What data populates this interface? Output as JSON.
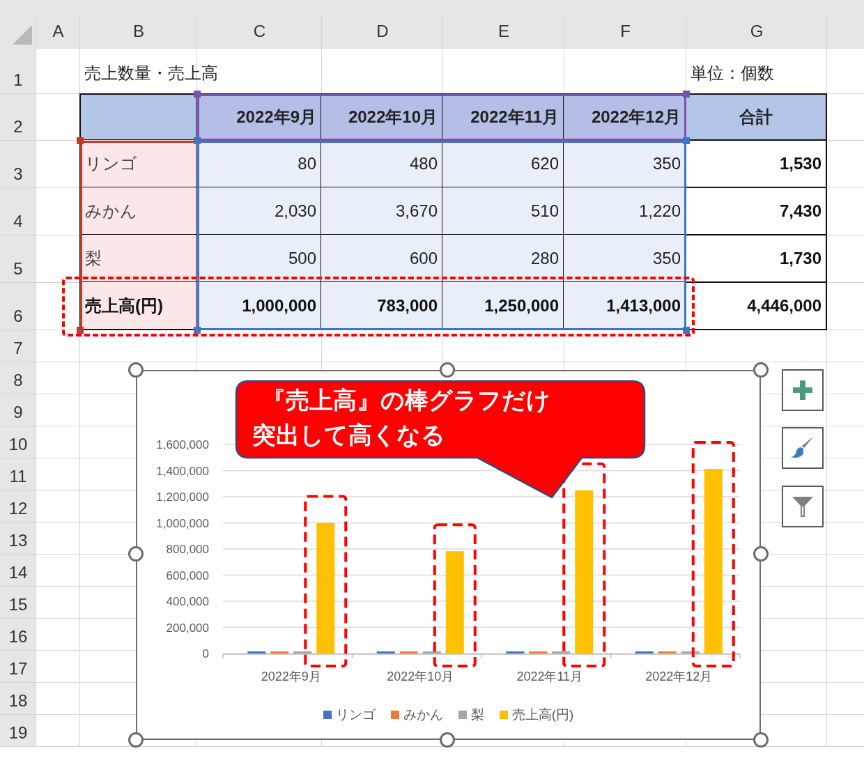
{
  "columns": [
    "A",
    "B",
    "C",
    "D",
    "E",
    "F",
    "G"
  ],
  "row_numbers": [
    "1",
    "2",
    "3",
    "4",
    "5",
    "6",
    "7",
    "8",
    "9",
    "10",
    "11",
    "12",
    "13",
    "14",
    "15",
    "16",
    "17",
    "18",
    "19"
  ],
  "sheet_title": "売上数量・売上高",
  "unit_note": "単位：個数",
  "table": {
    "header": [
      "2022年9月",
      "2022年10月",
      "2022年11月",
      "2022年12月",
      "合計"
    ],
    "rows": [
      {
        "kind": "quantity",
        "label": "リンゴ",
        "values": [
          "80",
          "480",
          "620",
          "350"
        ],
        "total": "1,530"
      },
      {
        "kind": "quantity",
        "label": "みかん",
        "values": [
          "2,030",
          "3,670",
          "510",
          "1,220"
        ],
        "total": "7,430"
      },
      {
        "kind": "quantity",
        "label": "梨",
        "values": [
          "500",
          "600",
          "280",
          "350"
        ],
        "total": "1,730"
      },
      {
        "kind": "sales",
        "label": "売上高(円)",
        "values": [
          "1,000,000",
          "783,000",
          "1,250,000",
          "1,413,000"
        ],
        "total": "4,446,000",
        "highlighted": true
      }
    ]
  },
  "chart": {
    "last_series_bars_framed": true,
    "callout": [
      "『売上高』の棒グラフだけ",
      "突出して高くなる"
    ],
    "chart_data": {
      "type": "bar",
      "categories": [
        "2022年9月",
        "2022年10月",
        "2022年11月",
        "2022年12月"
      ],
      "series": [
        {
          "name": "リンゴ",
          "color": "#4472c4",
          "values": [
            80,
            480,
            620,
            350
          ]
        },
        {
          "name": "みかん",
          "color": "#ed7d31",
          "values": [
            2030,
            3670,
            510,
            1220
          ]
        },
        {
          "name": "梨",
          "color": "#a5a5a5",
          "values": [
            500,
            600,
            280,
            350
          ]
        },
        {
          "name": "売上高(円)",
          "color": "#ffc000",
          "values": [
            1000000,
            783000,
            1250000,
            1413000
          ]
        }
      ],
      "grid": true,
      "ylim": [
        0,
        1600000
      ],
      "yticks": [
        {
          "value": 0,
          "label": "0"
        },
        {
          "value": 200000,
          "label": "200,000"
        },
        {
          "value": 400000,
          "label": "400,000"
        },
        {
          "value": 600000,
          "label": "600,000"
        },
        {
          "value": 800000,
          "label": "800,000"
        },
        {
          "value": 1000000,
          "label": "1,000,000"
        },
        {
          "value": 1200000,
          "label": "1,200,000"
        },
        {
          "value": 1400000,
          "label": "1,400,000"
        },
        {
          "value": 1600000,
          "label": "1,600,000"
        }
      ]
    }
  }
}
